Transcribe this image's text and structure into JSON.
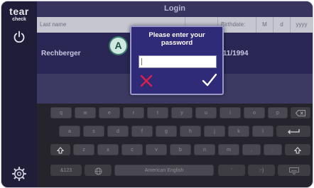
{
  "app": {
    "logo_line1": "tear",
    "logo_line2": "check",
    "title": "Login"
  },
  "table": {
    "columns": [
      "Last name",
      "",
      "Birthdate:",
      "M",
      "d",
      "yyyy"
    ],
    "row": {
      "last_name": "Rechberger",
      "birthdate_partial": "/11/1994"
    }
  },
  "dialog": {
    "title_line1": "Please enter your",
    "title_line2": "password",
    "password_value": ""
  },
  "annotation": {
    "label": "A"
  },
  "keyboard": {
    "row1": [
      "q",
      "w",
      "e",
      "r",
      "t",
      "y",
      "u",
      "i",
      "o",
      "p"
    ],
    "row2": [
      "a",
      "s",
      "d",
      "f",
      "g",
      "h",
      "j",
      "k",
      "l"
    ],
    "row3": [
      "z",
      "x",
      "c",
      "v",
      "b",
      "n",
      "m",
      ",",
      "."
    ],
    "symbols_key": "&123",
    "space_label": "American English",
    "apostrophe_key": "'",
    "smiley_key": ":-)"
  },
  "colors": {
    "accent": "#2f2b78",
    "cancel": "#d9204a",
    "confirm": "#ffffff"
  }
}
